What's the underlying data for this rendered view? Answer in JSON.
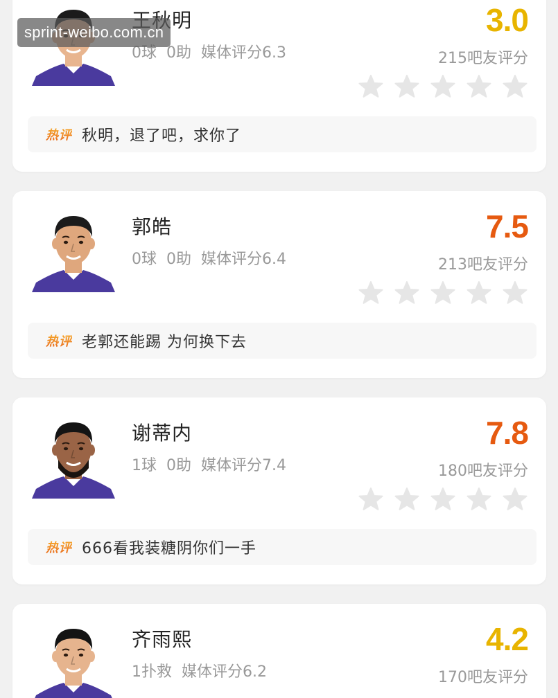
{
  "watermark": "sprint-weibo.com.cn",
  "hot_tag": "热评",
  "players": [
    {
      "name": "王秋明",
      "goals": "0球",
      "assists": "0助",
      "media_rating": "媒体评分6.3",
      "rating": "3.0",
      "rating_color": "#e8b400",
      "rating_count": "215吧友评分",
      "stars_filled": 0,
      "comment": "秋明，退了吧，求你了",
      "avatar": {
        "skin": "#e8b58f",
        "hair": "#1b1b1b",
        "jersey": "#4a3a9e",
        "beard": false
      }
    },
    {
      "name": "郭皓",
      "goals": "0球",
      "assists": "0助",
      "media_rating": "媒体评分6.4",
      "rating": "7.5",
      "rating_color": "#e65a10",
      "rating_count": "213吧友评分",
      "stars_filled": 0,
      "comment": "老郭还能踢 为何换下去",
      "avatar": {
        "skin": "#dfa77d",
        "hair": "#1b1b1b",
        "jersey": "#4a3a9e",
        "beard": false
      }
    },
    {
      "name": "谢蒂内",
      "goals": "1球",
      "assists": "0助",
      "media_rating": "媒体评分7.4",
      "rating": "7.8",
      "rating_color": "#e65a10",
      "rating_count": "180吧友评分",
      "stars_filled": 0,
      "comment": "666看我装糖阴你们一手",
      "avatar": {
        "skin": "#9a6446",
        "hair": "#141414",
        "jersey": "#4a3a9e",
        "beard": true
      }
    },
    {
      "name": "齐雨熙",
      "goals": "1扑救",
      "assists": "",
      "media_rating": "媒体评分6.2",
      "rating": "4.2",
      "rating_color": "#e8b400",
      "rating_count": "170吧友评分",
      "stars_filled": 0,
      "comment": "",
      "avatar": {
        "skin": "#e6b48e",
        "hair": "#141414",
        "jersey": "#4a3a9e",
        "beard": false
      }
    }
  ]
}
